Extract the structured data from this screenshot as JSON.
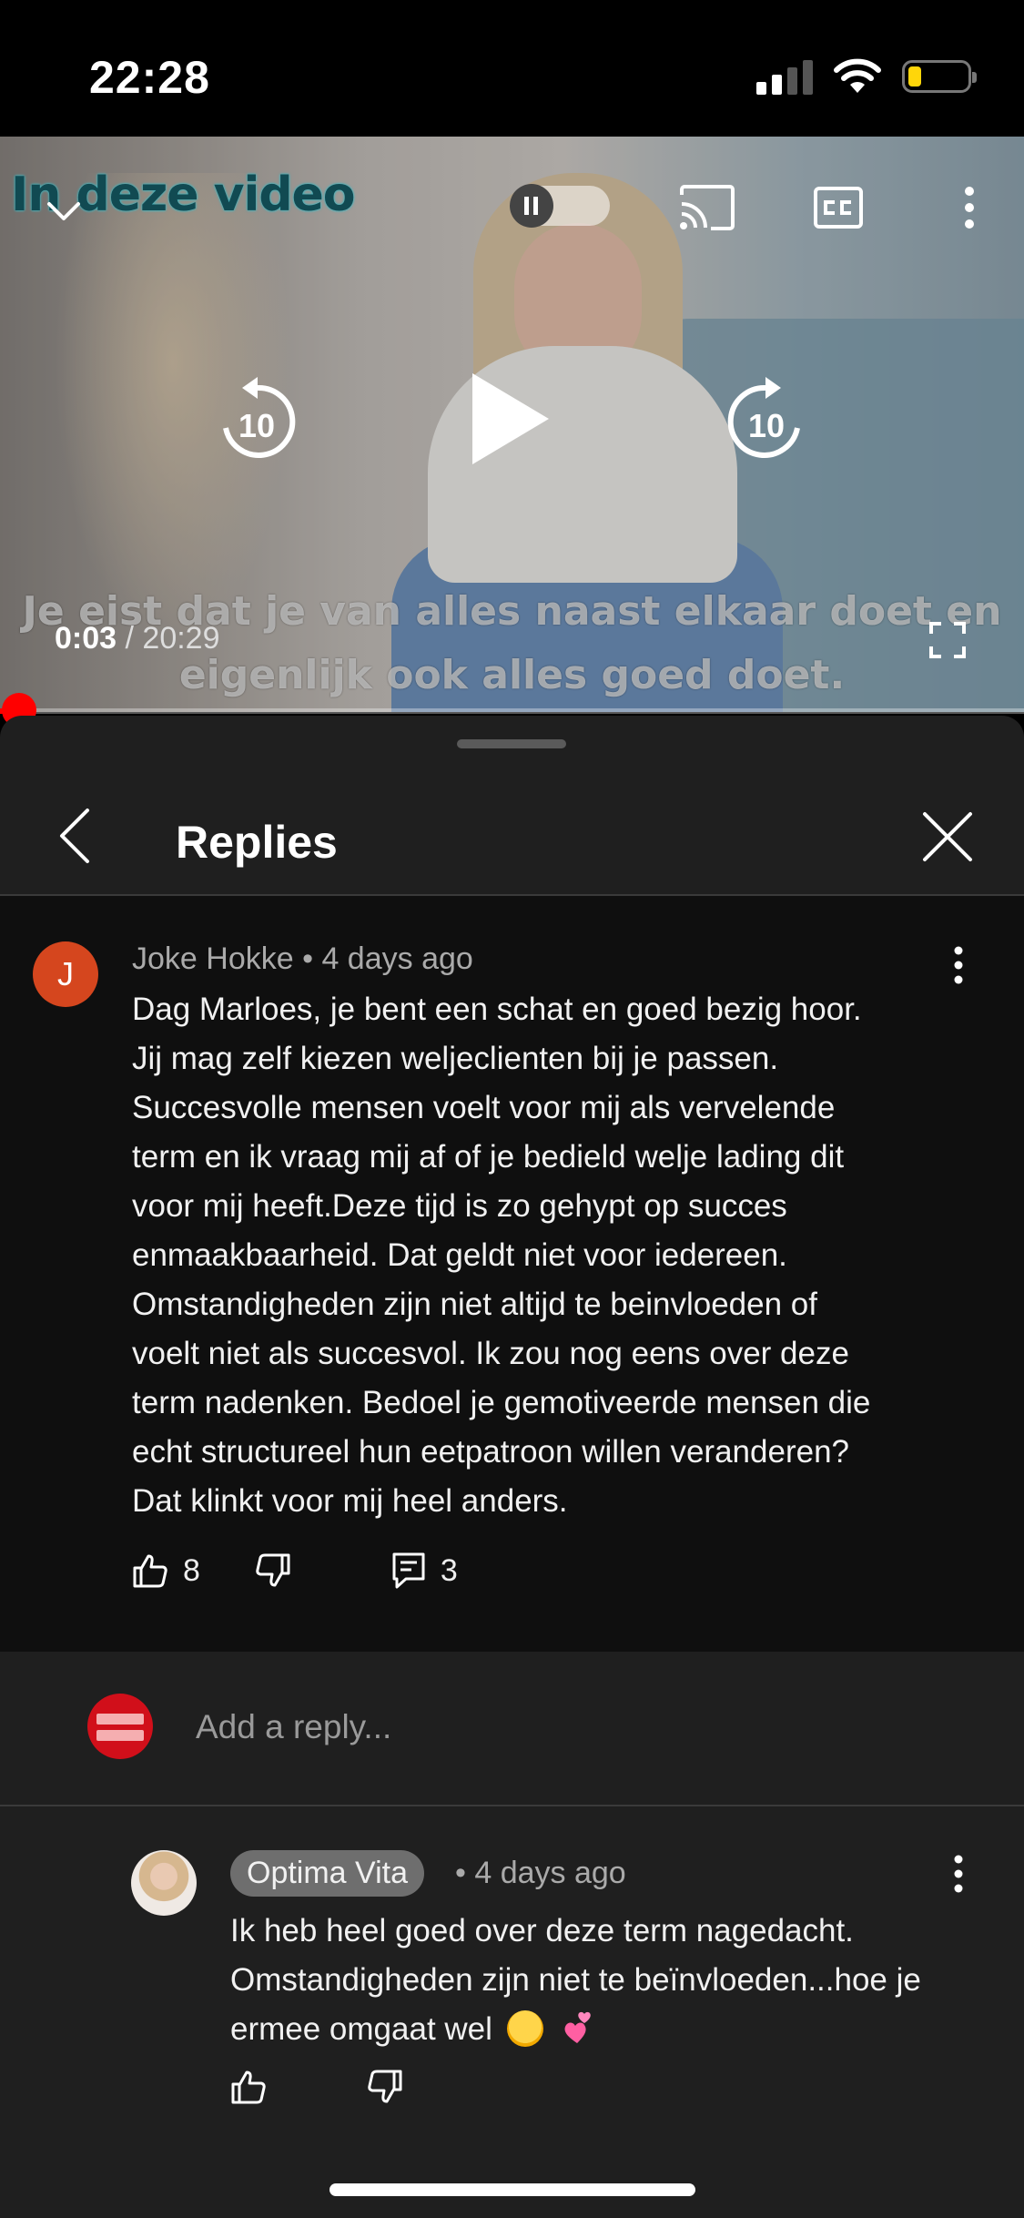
{
  "status_bar": {
    "time": "22:28"
  },
  "video": {
    "overlay_text": "In deze video",
    "current_time": "0:03",
    "duration": "/ 20:29",
    "subtitle_line1": "Je eist dat je van alles naast elkaar doet en",
    "subtitle_line2": "eigenlijk ook alles goed doet.",
    "progress": 0.003,
    "seek_back_seconds": "10",
    "seek_forward_seconds": "10"
  },
  "sheet": {
    "title": "Replies"
  },
  "comment": {
    "avatar_letter": "J",
    "author": "Joke Hokke",
    "separator": "•",
    "time": "4 days ago",
    "text": "Dag Marloes, je bent een schat en goed bezig hoor.\nJij mag zelf kiezen weljeclienten bij je passen.\nSuccesvolle mensen voelt voor mij als vervelende\nterm en ik vraag mij af of je bedield welje lading dit\nvoor mij heeft.Deze tijd is zo gehypt op succes\nenmaakbaarheid. Dat geldt niet voor iedereen.\nOmstandigheden zijn niet altijd te beinvloeden of\nvoelt niet als succesvol. Ik zou nog eens over deze\nterm nadenken. Bedoel je gemotiveerde mensen die\necht structureel hun eetpatroon willen veranderen?\nDat klinkt voor mij heel anders.",
    "likes": "8",
    "replies": "3"
  },
  "reply_box": {
    "placeholder": "Add a reply..."
  },
  "reply": {
    "author": "Optima Vita",
    "time": "• 4 days ago",
    "text": "Ik heb heel goed over deze term nagedacht. Omstandigheden zijn niet te beïnvloeden...hoe je ermee omgaat wel"
  }
}
